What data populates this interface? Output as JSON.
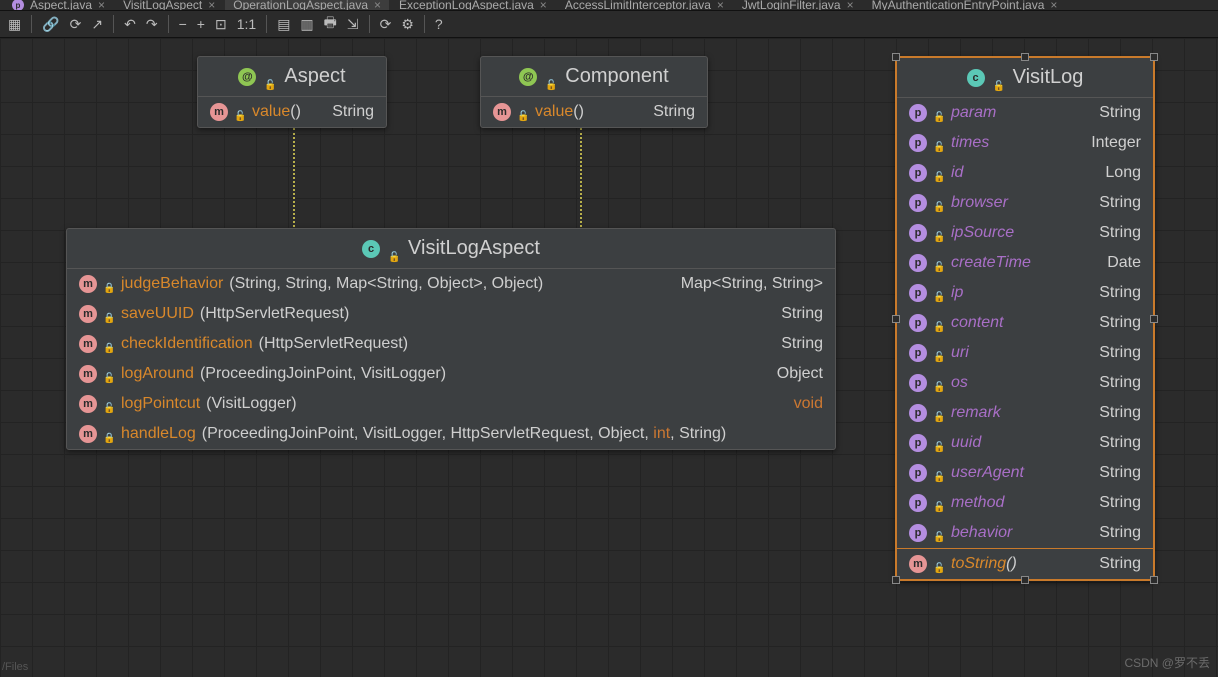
{
  "tabs": [
    {
      "label": "Aspect.java",
      "active": false
    },
    {
      "label": "VisitLogAspect",
      "active": false
    },
    {
      "label": "OperationLogAspect.java",
      "active": true
    },
    {
      "label": "ExceptionLogAspect.java",
      "active": false
    },
    {
      "label": "AccessLimitInterceptor.java",
      "active": false
    },
    {
      "label": "JwtLoginFilter.java",
      "active": false
    },
    {
      "label": "MyAuthenticationEntryPoint.java",
      "active": false
    }
  ],
  "sidebar_file": "/Files",
  "watermark": "CSDN @罗不丢",
  "aspect": {
    "title": "Aspect",
    "member": {
      "name": "value",
      "ret": "String"
    }
  },
  "component": {
    "title": "Component",
    "member": {
      "name": "value",
      "ret": "String"
    }
  },
  "visitLogAspect": {
    "title": "VisitLogAspect",
    "rows": [
      {
        "badge": "m",
        "vis": "lock",
        "name": "judgeBehavior",
        "params": "(String, String, Map<String, Object>, Object)",
        "ret": "Map<String, String>"
      },
      {
        "badge": "m",
        "vis": "lock",
        "name": "saveUUID",
        "params": " (HttpServletRequest)",
        "ret": "String"
      },
      {
        "badge": "m",
        "vis": "lock",
        "name": "checkIdentification",
        "params": "(HttpServletRequest)",
        "ret": "String"
      },
      {
        "badge": "m",
        "vis": "open",
        "name": "logAround",
        "params": "(ProceedingJoinPoint, VisitLogger)",
        "ret": "Object"
      },
      {
        "badge": "m",
        "vis": "open",
        "name": "logPointcut",
        "params": "(VisitLogger)",
        "ret": "void"
      },
      {
        "badge": "m",
        "vis": "lock",
        "name": "handleLog",
        "params_pre": "(ProceedingJoinPoint, VisitLogger, HttpServletRequest, Object, ",
        "params_kw": "int",
        "params_post": ", String)",
        "ret": ""
      }
    ]
  },
  "visitLog": {
    "title": "VisitLog",
    "props": [
      {
        "name": "param",
        "type": "String"
      },
      {
        "name": "times",
        "type": "Integer"
      },
      {
        "name": "id",
        "type": "Long"
      },
      {
        "name": "browser",
        "type": "String"
      },
      {
        "name": "ipSource",
        "type": "String"
      },
      {
        "name": "createTime",
        "type": "Date"
      },
      {
        "name": "ip",
        "type": "String"
      },
      {
        "name": "content",
        "type": "String"
      },
      {
        "name": "uri",
        "type": "String"
      },
      {
        "name": "os",
        "type": "String"
      },
      {
        "name": "remark",
        "type": "String"
      },
      {
        "name": "uuid",
        "type": "String"
      },
      {
        "name": "userAgent",
        "type": "String"
      },
      {
        "name": "method",
        "type": "String"
      },
      {
        "name": "behavior",
        "type": "String"
      }
    ],
    "method": {
      "name": "toString",
      "ret": "String"
    }
  }
}
